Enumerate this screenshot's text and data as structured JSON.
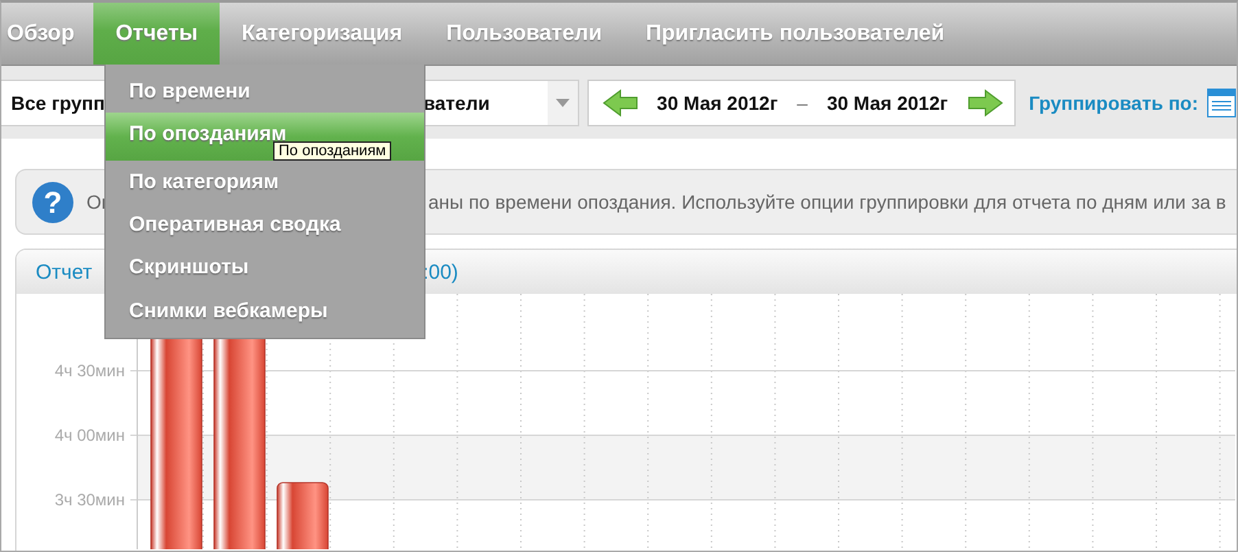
{
  "nav": {
    "tabs": [
      {
        "label": "Обзор",
        "selected": false
      },
      {
        "label": "Отчеты",
        "selected": true
      },
      {
        "label": "Категоризация",
        "selected": false
      },
      {
        "label": "Пользователи",
        "selected": false
      },
      {
        "label": "Пригласить пользователей",
        "selected": false
      }
    ]
  },
  "reports_menu": {
    "items": [
      {
        "label": "По времени",
        "selected": false
      },
      {
        "label": "По опозданиям",
        "selected": true
      },
      {
        "label": "По категориям",
        "selected": false
      },
      {
        "label": "Оперативная сводка",
        "selected": false
      },
      {
        "label": "Скриншоты",
        "selected": false
      },
      {
        "label": "Снимки вебкамеры",
        "selected": false
      }
    ],
    "tooltip": "По опозданиям"
  },
  "toolbar": {
    "group_select": {
      "value_start": "Все групп",
      "value_end": "ватели"
    },
    "date_range": {
      "from": "30 Мая 2012г",
      "separator": "–",
      "to": "30 Мая 2012г"
    },
    "group_by_label": "Группировать по:"
  },
  "info": {
    "icon_glyph": "?",
    "text_start": "Ог",
    "text_end": "аны по времени опоздания. Используйте опции группировки для отчета по дням или за в"
  },
  "report": {
    "title_start": "Отчет",
    "title_end": ":00)",
    "y_axis_labels": [
      "4ч 30мин",
      "4ч 00мин",
      "3ч 30мин"
    ]
  }
}
